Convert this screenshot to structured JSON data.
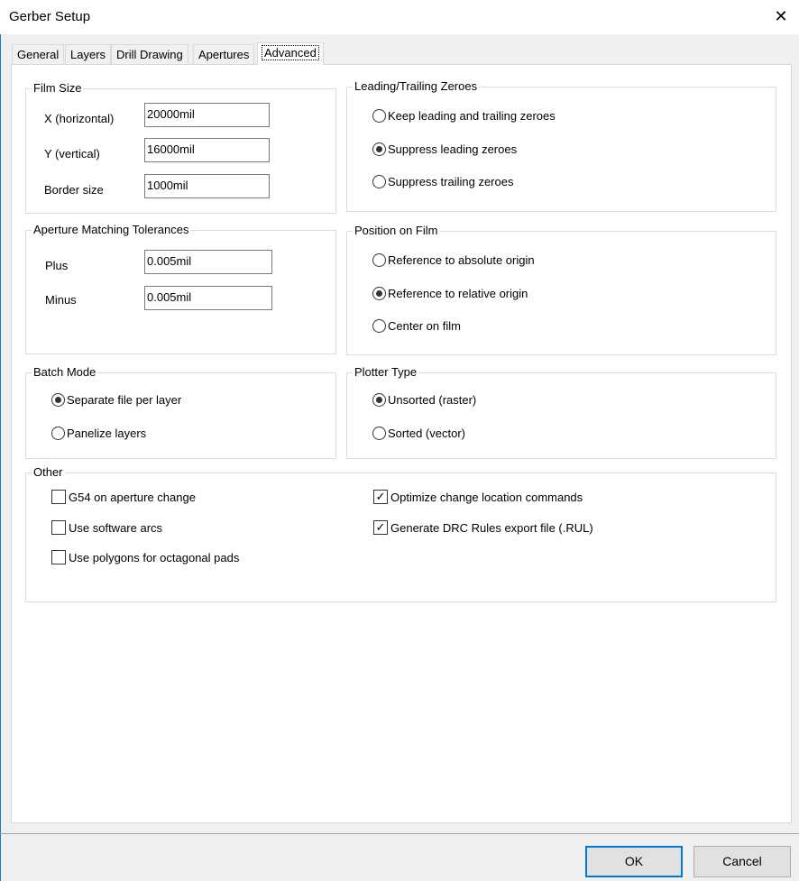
{
  "window": {
    "title": "Gerber Setup",
    "close_glyph": "✕"
  },
  "tabs": [
    {
      "label": "General"
    },
    {
      "label": "Layers"
    },
    {
      "label": "Drill Drawing"
    },
    {
      "label": "Apertures"
    },
    {
      "label": "Advanced",
      "active": true
    }
  ],
  "film_size": {
    "title": "Film Size",
    "x_label": "X (horizontal)",
    "x_value": "20000mil",
    "y_label": "Y (vertical)",
    "y_value": "16000mil",
    "border_label": "Border size",
    "border_value": "1000mil"
  },
  "aperture_tolerances": {
    "title": "Aperture Matching Tolerances",
    "plus_label": "Plus",
    "plus_value": "0.005mil",
    "minus_label": "Minus",
    "minus_value": "0.005mil"
  },
  "batch_mode": {
    "title": "Batch Mode",
    "options": [
      {
        "label": "Separate file per layer",
        "selected": true
      },
      {
        "label": "Panelize layers",
        "selected": false
      }
    ]
  },
  "zeroes": {
    "title": "Leading/Trailing Zeroes",
    "options": [
      {
        "label": "Keep leading and trailing zeroes",
        "selected": false
      },
      {
        "label": "Suppress leading zeroes",
        "selected": true
      },
      {
        "label": "Suppress trailing zeroes",
        "selected": false
      }
    ]
  },
  "position": {
    "title": "Position on Film",
    "options": [
      {
        "label": "Reference to absolute origin",
        "selected": false
      },
      {
        "label": "Reference to relative origin",
        "selected": true
      },
      {
        "label": "Center on film",
        "selected": false
      }
    ]
  },
  "plotter": {
    "title": "Plotter Type",
    "options": [
      {
        "label": "Unsorted (raster)",
        "selected": true
      },
      {
        "label": "Sorted (vector)",
        "selected": false
      }
    ]
  },
  "other": {
    "title": "Other",
    "checks": [
      {
        "label": "G54 on aperture change",
        "checked": false
      },
      {
        "label": "Use software arcs",
        "checked": false
      },
      {
        "label": "Use polygons for octagonal pads",
        "checked": false
      },
      {
        "label": "Optimize change location commands",
        "checked": true
      },
      {
        "label": "Generate DRC Rules export file (.RUL)",
        "checked": true
      }
    ]
  },
  "buttons": {
    "ok": "OK",
    "cancel": "Cancel"
  },
  "colors": {
    "accent": "#0078d7"
  }
}
